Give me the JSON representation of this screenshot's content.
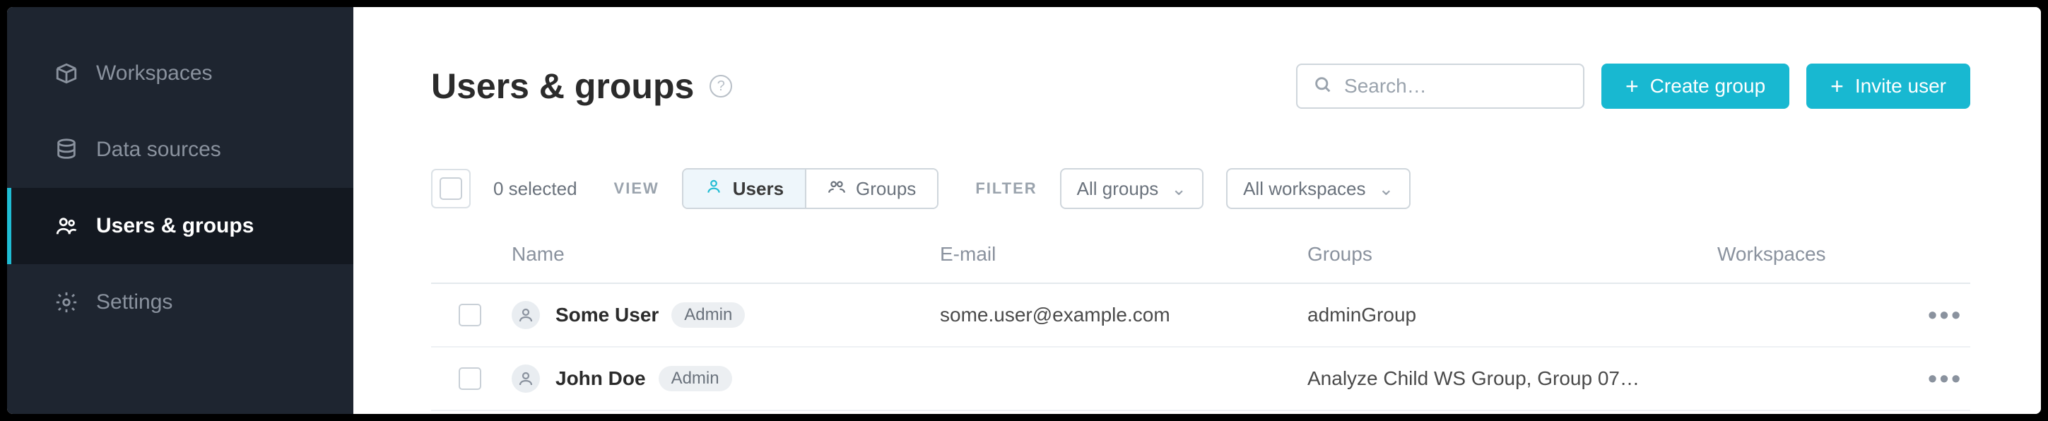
{
  "sidebar": {
    "items": [
      {
        "label": "Workspaces"
      },
      {
        "label": "Data sources"
      },
      {
        "label": "Users & groups"
      },
      {
        "label": "Settings"
      }
    ]
  },
  "header": {
    "title": "Users & groups",
    "search_placeholder": "Search…",
    "create_group": "Create group",
    "invite_user": "Invite user"
  },
  "toolbar": {
    "selected_text": "0 selected",
    "view_label": "VIEW",
    "users_tab": "Users",
    "groups_tab": "Groups",
    "filter_label": "FILTER",
    "all_groups": "All groups",
    "all_workspaces": "All workspaces"
  },
  "table": {
    "headers": {
      "name": "Name",
      "email": "E-mail",
      "groups": "Groups",
      "workspaces": "Workspaces"
    },
    "rows": [
      {
        "name": "Some User",
        "role": "Admin",
        "email": "some.user@example.com",
        "groups": "adminGroup",
        "workspaces": ""
      },
      {
        "name": "John Doe",
        "role": "Admin",
        "email": "",
        "groups": "Analyze Child WS Group, Group 07…",
        "workspaces": ""
      }
    ]
  }
}
